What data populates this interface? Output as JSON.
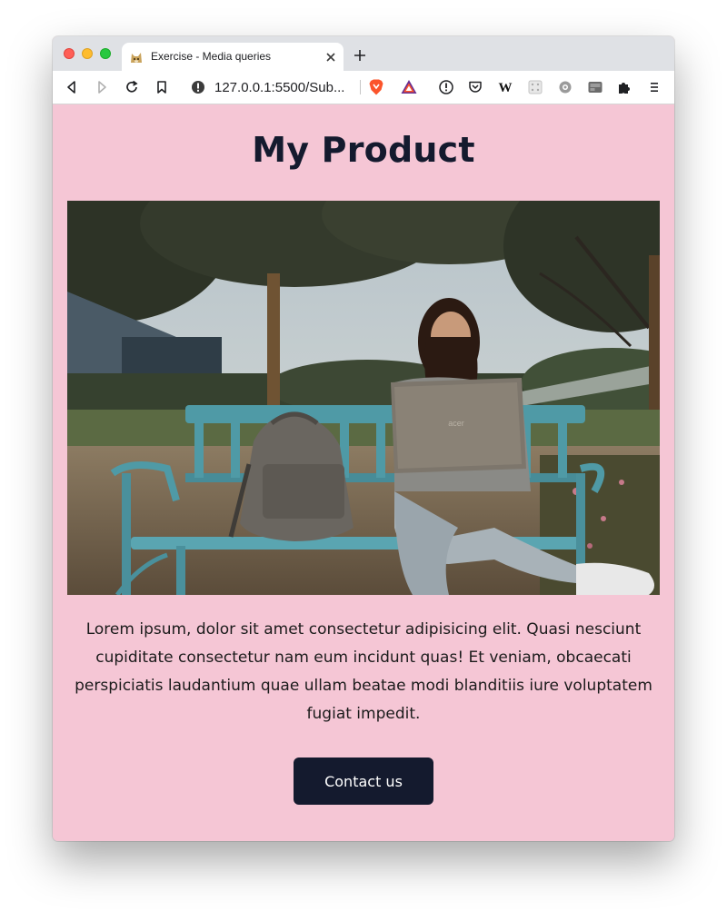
{
  "browser": {
    "tab_title": "Exercise - Media queries",
    "url": "127.0.0.1:5500/Sub..."
  },
  "page": {
    "title": "My Product",
    "image_alt": "Woman sitting on a bench using a laptop next to a backpack",
    "description": "Lorem ipsum, dolor sit amet consectetur adipisicing elit. Quasi nesciunt cupiditate consectetur nam eum incidunt quas! Et veniam, obcaecati perspiciatis laudantium quae ullam beatae modi blanditiis iure voluptatem fugiat impedit.",
    "button_label": "Contact us"
  },
  "colors": {
    "page_background": "#f5c6d5",
    "heading": "#141a2e",
    "button_background": "#141a2e",
    "button_text": "#ffffff"
  },
  "icons": [
    "back-icon",
    "forward-icon",
    "reload-icon",
    "bookmark-icon",
    "site-info-icon",
    "brave-shields-icon",
    "brave-rewards-icon",
    "pocket-icon",
    "wikipedia-icon",
    "extension-icon",
    "settings-gear-icon",
    "puzzle-extensions-icon",
    "menu-icon",
    "new-tab-icon",
    "close-tab-icon"
  ]
}
